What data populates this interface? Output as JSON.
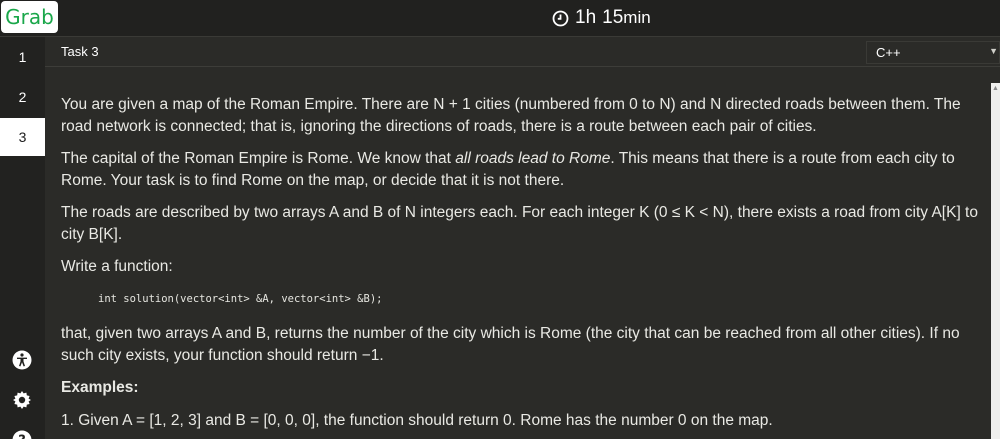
{
  "header": {
    "logo_text": "Grab",
    "timer_hours": "1h",
    "timer_minutes": "15",
    "timer_unit": "min"
  },
  "sidebar": {
    "tasks": [
      "1",
      "2",
      "3"
    ],
    "active_task": "3",
    "icons": [
      "accessibility-icon",
      "settings-icon",
      "help-icon"
    ]
  },
  "task": {
    "title": "Task 3",
    "language": "C++"
  },
  "statement": {
    "p1": "You are given a map of the Roman Empire. There are N + 1 cities (numbered from 0 to N) and N directed roads between them. The road network is connected; that is, ignoring the directions of roads, there is a route between each pair of cities.",
    "p2_pre": "The capital of the Roman Empire is Rome. We know that ",
    "p2_em": "all roads lead to Rome",
    "p2_post": ". This means that there is a route from each city to Rome. Your task is to find Rome on the map, or decide that it is not there.",
    "p3": "The roads are described by two arrays A and B of N integers each. For each integer K (0 ≤ K < N), there exists a road from city A[K] to city B[K].",
    "p4": "Write a function:",
    "code": "int solution(vector<int> &A, vector<int> &B);",
    "p5": "that, given two arrays A and B, returns the number of the city which is Rome (the city that can be reached from all other cities). If no such city exists, your function should return −1.",
    "examples_heading": "Examples:",
    "example1": "1. Given A = [1, 2, 3] and B = [0, 0, 0], the function should return 0. Rome has the number 0 on the map."
  },
  "colors": {
    "background": "#2b2b28",
    "sidebar": "#222220",
    "brand_green": "#1aa74a"
  }
}
